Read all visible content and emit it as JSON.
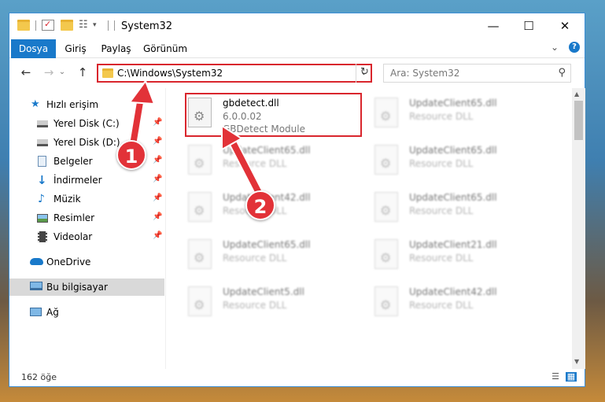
{
  "window": {
    "title": "System32",
    "controls": {
      "minimize": "—",
      "maximize": "☐",
      "close": "✕"
    }
  },
  "ribbon": {
    "tabs": [
      {
        "label": "Dosya"
      },
      {
        "label": "Giriş"
      },
      {
        "label": "Paylaş"
      },
      {
        "label": "Görünüm"
      }
    ],
    "expand_glyph": "⌄",
    "help_glyph": "?"
  },
  "nav": {
    "back": "←",
    "forward": "→",
    "recent": "⌄",
    "up": "↑",
    "address": "C:\\Windows\\System32",
    "address_dropdown": "⌄",
    "refresh": "↻",
    "search_placeholder": "Ara: System32",
    "search_glyph": "⚲"
  },
  "sidebar": {
    "items": [
      {
        "label": "Hızlı erişim",
        "icon": "star-icon"
      },
      {
        "label": "Yerel Disk (C:)",
        "icon": "drive-icon",
        "pinned": true
      },
      {
        "label": "Yerel Disk (D:)",
        "icon": "drive-icon",
        "pinned": true
      },
      {
        "label": "Belgeler",
        "icon": "documents-icon",
        "pinned": true
      },
      {
        "label": "İndirmeler",
        "icon": "downloads-icon",
        "pinned": true
      },
      {
        "label": "Müzik",
        "icon": "music-icon",
        "pinned": true
      },
      {
        "label": "Resimler",
        "icon": "pictures-icon",
        "pinned": true
      },
      {
        "label": "Videolar",
        "icon": "videos-icon",
        "pinned": true
      },
      {
        "label": "OneDrive",
        "icon": "cloud-icon"
      },
      {
        "label": "Bu bilgisayar",
        "icon": "computer-icon",
        "selected": true
      },
      {
        "label": "Ağ",
        "icon": "network-icon"
      }
    ],
    "pin_glyph": "📌"
  },
  "files": {
    "highlighted": {
      "name": "gbdetect.dll",
      "version": "6.0.0.02",
      "description": "GBDetect Module"
    },
    "left_column": [
      {
        "name": "UpdateClient65.dll",
        "description": "Resource DLL"
      },
      {
        "name": "UpdateClient42.dll",
        "description": "Resource DLL"
      },
      {
        "name": "UpdateClient65.dll",
        "description": "Resource DLL"
      },
      {
        "name": "UpdateClient5.dll",
        "description": "Resource DLL"
      }
    ],
    "right_column": [
      {
        "name": "UpdateClient65.dll",
        "description": "Resource DLL"
      },
      {
        "name": "UpdateClient65.dll",
        "description": "Resource DLL"
      },
      {
        "name": "UpdateClient65.dll",
        "description": "Resource DLL"
      },
      {
        "name": "UpdateClient21.dll",
        "description": "Resource DLL"
      },
      {
        "name": "UpdateClient42.dll",
        "description": "Resource DLL"
      }
    ]
  },
  "status": {
    "count": "162 öğe"
  },
  "callouts": {
    "one": "1",
    "two": "2"
  },
  "colors": {
    "accent": "#1979ca",
    "highlight": "#d9262d",
    "callout": "#e23238"
  }
}
